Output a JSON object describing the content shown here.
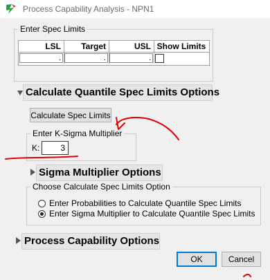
{
  "window": {
    "title": "Process Capability Analysis - NPN1",
    "icon": "jmp-app-icon"
  },
  "spec_limits": {
    "group_label": "Enter Spec Limits",
    "columns": [
      "LSL",
      "Target",
      "USL",
      "Show Limits"
    ],
    "values": [
      ".",
      ".",
      "."
    ],
    "show_limits_checked": false
  },
  "quantile_section": {
    "title": "Calculate Quantile Spec Limits Options",
    "expanded": true,
    "calculate_button": "Calculate Spec Limits",
    "ksigma_group_label": "Enter K-Sigma Multiplier",
    "k_label": "K:",
    "k_value": "3"
  },
  "sigma_section": {
    "title": "Sigma Multiplier Options",
    "expanded": false
  },
  "calc_option_group": {
    "label": "Choose Calculate Spec Limits Option",
    "options": [
      {
        "label": "Enter Probabilities to Calculate Quantile Spec Limits",
        "selected": false
      },
      {
        "label": "Enter Sigma Multiplier to Calculate Quantile Spec Limits",
        "selected": true
      }
    ]
  },
  "process_section": {
    "title": "Process Capability Options",
    "expanded": false
  },
  "footer": {
    "ok_label": "OK",
    "cancel_label": "Cancel"
  },
  "annotation_color": "#e00000",
  "accent_color": "#0078d7"
}
